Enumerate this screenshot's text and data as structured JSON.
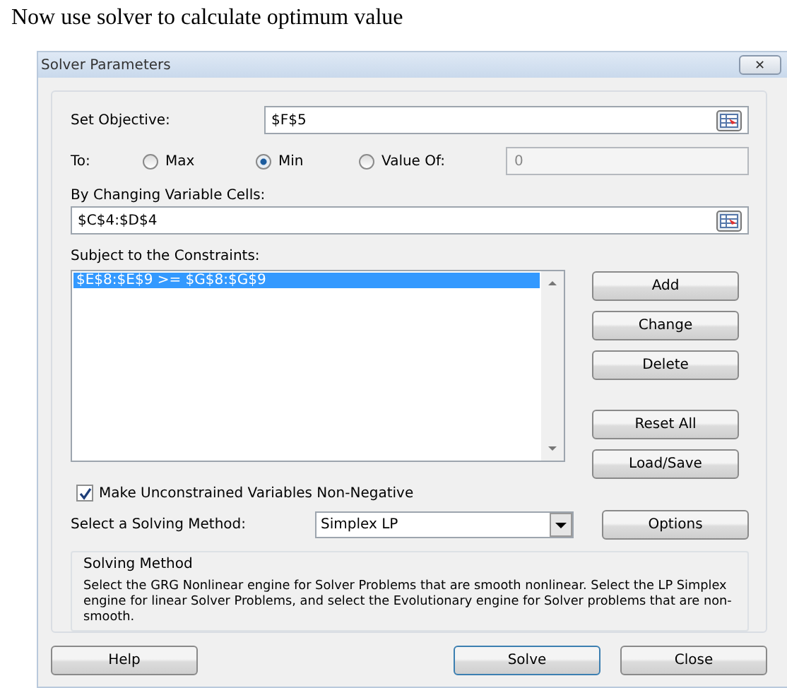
{
  "heading": "Now use solver to calculate optimum value",
  "window": {
    "title": "Solver Parameters",
    "close": "✕"
  },
  "objective": {
    "label": "Set Objective:",
    "value": "$F$5"
  },
  "to": {
    "label": "To:",
    "options": [
      {
        "label": "Max",
        "selected": false
      },
      {
        "label": "Min",
        "selected": true
      },
      {
        "label": "Value Of:",
        "selected": false
      }
    ],
    "value_field": "0"
  },
  "changing": {
    "label": "By Changing Variable Cells:",
    "value": "$C$4:$D$4"
  },
  "constraints": {
    "label": "Subject to the Constraints:",
    "items": [
      {
        "text": "$E$8:$E$9 >= $G$8:$G$9",
        "selected": true
      }
    ]
  },
  "side_buttons": [
    "Add",
    "Change",
    "Delete",
    "Reset All",
    "Load/Save"
  ],
  "nonnegative": {
    "label": "Make Unconstrained Variables Non-Negative",
    "checked": true
  },
  "method": {
    "label": "Select a Solving Method:",
    "value": "Simplex LP",
    "options_button": "Options"
  },
  "info": {
    "title": "Solving Method",
    "text": "Select the GRG Nonlinear engine for Solver Problems that are smooth nonlinear. Select the LP Simplex engine for linear Solver Problems, and select the Evolutionary engine for Solver problems that are non-smooth."
  },
  "footer": [
    {
      "label": "Help",
      "default": false
    },
    {
      "label": "Solve",
      "default": true
    },
    {
      "label": "Close",
      "default": false
    }
  ]
}
